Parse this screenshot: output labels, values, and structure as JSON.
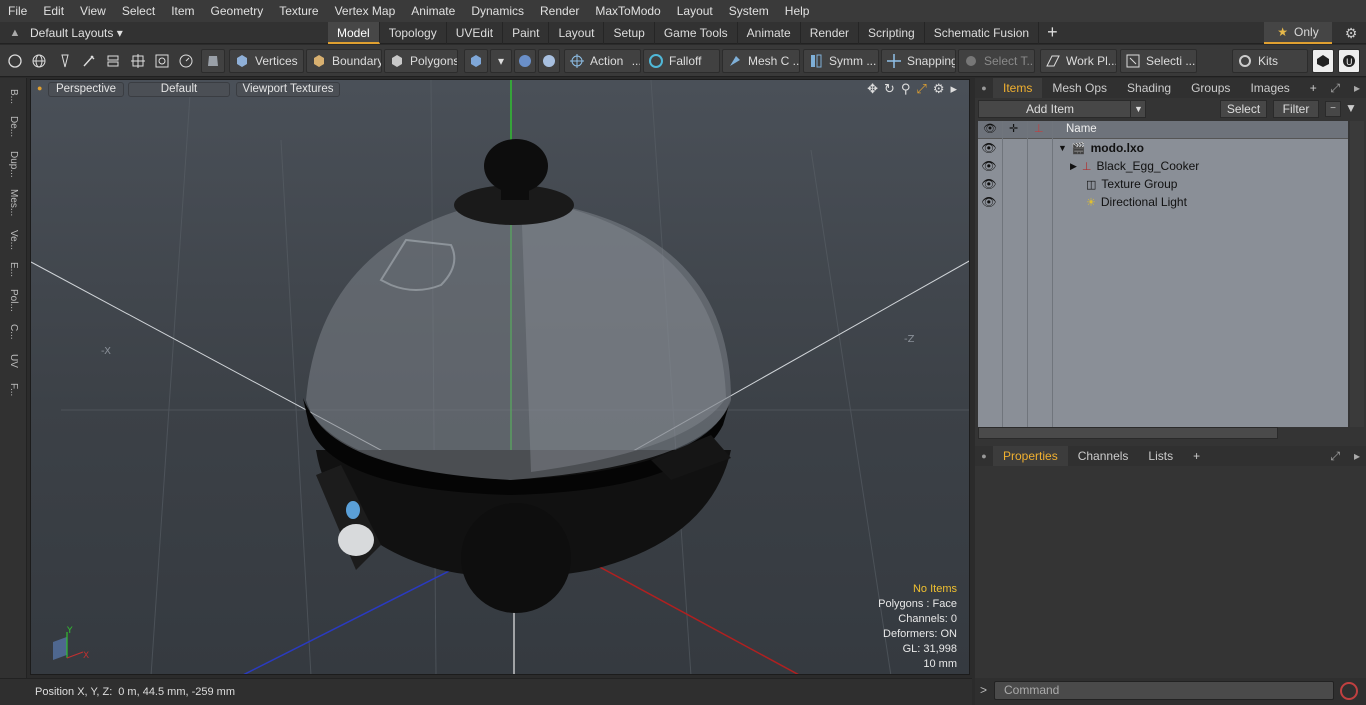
{
  "menu": [
    "File",
    "Edit",
    "View",
    "Select",
    "Item",
    "Geometry",
    "Texture",
    "Vertex Map",
    "Animate",
    "Dynamics",
    "Render",
    "MaxToModo",
    "Layout",
    "System",
    "Help"
  ],
  "layout": {
    "label": "Default Layouts ▾"
  },
  "tabs": [
    "Model",
    "Topology",
    "UVEdit",
    "Paint",
    "Layout",
    "Setup",
    "Game Tools",
    "Animate",
    "Render",
    "Scripting",
    "Schematic Fusion"
  ],
  "active_tab": "Model",
  "only_label": "Only",
  "toolbar": {
    "vertices": "Vertices",
    "boundary": "Boundary",
    "polygons": "Polygons",
    "action": "Action",
    "falloff": "Falloff",
    "mesh": "Mesh C ...",
    "symm": "Symm ...",
    "snapping": "Snapping",
    "select_t": "Select T...",
    "work_pl": "Work Pl...",
    "selecti": "Selecti ...",
    "kits": "Kits"
  },
  "left_strip": [
    "B...",
    "De...",
    "Dup...",
    "Mes...",
    "Ve...",
    "E...",
    "Pol...",
    "C...",
    "UV",
    "F..."
  ],
  "viewport": {
    "perspective": "Perspective",
    "default": "Default",
    "viewport_textures": "Viewport Textures",
    "stats": {
      "no_items": "No Items",
      "polygons": "Polygons : Face",
      "channels": "Channels: 0",
      "deformers": "Deformers: ON",
      "gl": "GL: 31,998",
      "scale": "10 mm"
    },
    "axis_y": "Y",
    "axis_x": "X"
  },
  "status": {
    "label": "Position X, Y, Z:",
    "value": "0 m, 44.5 mm, -259 mm"
  },
  "items_panel": {
    "tabs": [
      "Items",
      "Mesh Ops",
      "Shading",
      "Groups",
      "Images"
    ],
    "add_item": "Add Item",
    "select": "Select",
    "filter": "Filter",
    "column_name": "Name",
    "rows": [
      {
        "name": "modo.lxo"
      },
      {
        "name": "Black_Egg_Cooker"
      },
      {
        "name": "Texture Group"
      },
      {
        "name": "Directional Light"
      }
    ]
  },
  "props_panel": {
    "tabs": [
      "Properties",
      "Channels",
      "Lists"
    ]
  },
  "command": {
    "placeholder": "Command"
  },
  "colors": {
    "accent": "#f0b030",
    "item_list_bg": "#8a8f97",
    "x_axis": "#b02020",
    "y_axis": "#20b020",
    "z_axis": "#2020b0"
  }
}
